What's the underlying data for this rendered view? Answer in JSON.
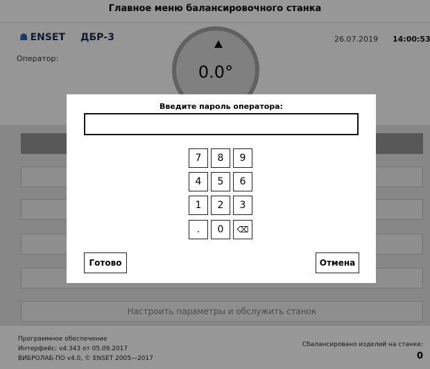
{
  "window": {
    "title": "Главное меню балансировочного станка"
  },
  "header": {
    "brand": "ENSET",
    "brand_icon": "enset-logo-icon",
    "model": "ДБР-3",
    "date": "26.07.2019",
    "time": "14:00:53",
    "operator_label": "Оператор:"
  },
  "dial": {
    "value": "0.0",
    "unit": "°"
  },
  "menu": {
    "items": [
      {
        "label": ""
      },
      {
        "label": ""
      },
      {
        "label": ""
      },
      {
        "label": ""
      },
      {
        "label": ""
      },
      {
        "label": "Настроить параметры и обслужить станок"
      }
    ]
  },
  "footer": {
    "software_label": "Программное обеспечение",
    "interface_version": "Интерфейс: v4.343 от 05.09.2017",
    "copyright": "ВИБРОЛАБ-ПО v4.0, © ENSET 2005—2017",
    "balanced_label": "Сбалансировано изделий на станке:",
    "balanced_count": "0"
  },
  "dialog": {
    "prompt": "Введите пароль оператора:",
    "password_value": "",
    "keypad": [
      "7",
      "8",
      "9",
      "4",
      "5",
      "6",
      "1",
      "2",
      "3",
      ".",
      "0"
    ],
    "backspace_icon": "backspace-icon",
    "ok_label": "Готово",
    "cancel_label": "Отмена"
  }
}
